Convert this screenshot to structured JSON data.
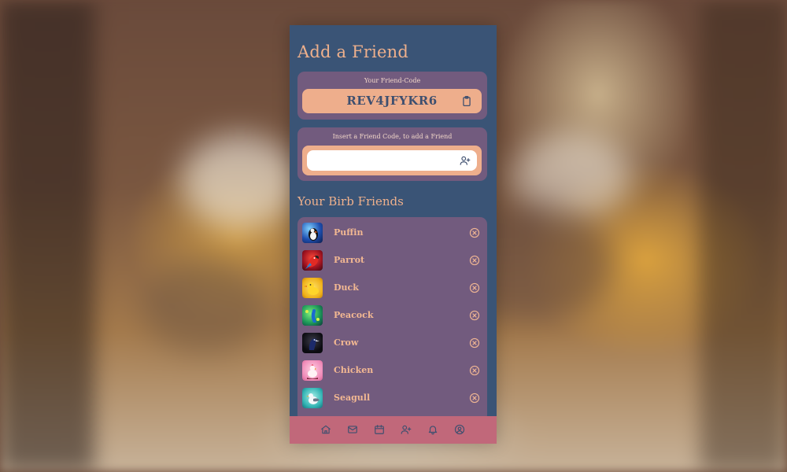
{
  "page": {
    "title": "Add a Friend"
  },
  "friend_code_card": {
    "label": "Your Friend-Code",
    "code": "REV4JFYKR6",
    "copy_icon": "clipboard-icon"
  },
  "insert_card": {
    "label": "Insert a Friend Code, to add a Friend",
    "input_value": "",
    "input_placeholder": "",
    "add_icon": "user-plus-icon"
  },
  "friends_section": {
    "title": "Your Birb Friends",
    "remove_icon": "circle-x-icon",
    "items": [
      {
        "name": "Puffin"
      },
      {
        "name": "Parrot"
      },
      {
        "name": "Duck"
      },
      {
        "name": "Peacock"
      },
      {
        "name": "Crow"
      },
      {
        "name": "Chicken"
      },
      {
        "name": "Seagull"
      }
    ]
  },
  "navbar": {
    "items": [
      {
        "icon": "home-icon"
      },
      {
        "icon": "mail-icon"
      },
      {
        "icon": "calendar-icon"
      },
      {
        "icon": "user-plus-icon"
      },
      {
        "icon": "bell-icon"
      },
      {
        "icon": "user-circle-icon"
      }
    ]
  },
  "colors": {
    "panel_bg": "#3a5476",
    "card_bg": "#725b7e",
    "accent_peach": "#eeae8c",
    "navbar_bg": "#c1687a",
    "code_text": "#3e4f6f"
  }
}
